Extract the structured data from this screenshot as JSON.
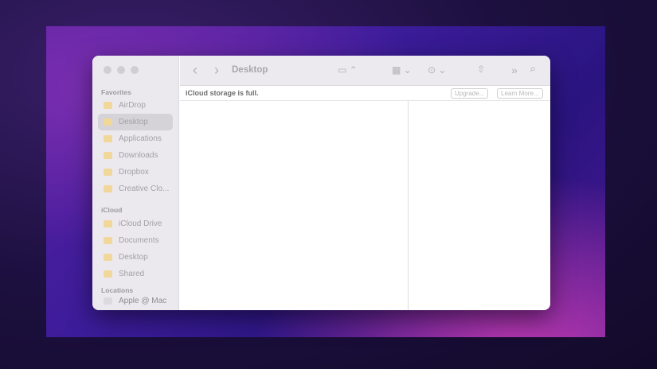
{
  "window": {
    "title": "Desktop"
  },
  "sidebar": {
    "favorites_label": "Favorites",
    "favorites": [
      {
        "label": "AirDrop"
      },
      {
        "label": "Desktop",
        "selected": true
      },
      {
        "label": "Applications"
      },
      {
        "label": "Downloads"
      },
      {
        "label": "Dropbox"
      },
      {
        "label": "Creative Clo..."
      }
    ],
    "icloud_label": "iCloud",
    "icloud": [
      {
        "label": "iCloud Drive"
      },
      {
        "label": "Documents"
      },
      {
        "label": "Desktop"
      },
      {
        "label": "Shared"
      }
    ],
    "locations_label": "Locations",
    "locations": [
      {
        "label": "Apple @ Mac"
      }
    ]
  },
  "toolbar": {
    "back": "‹",
    "forward": "›",
    "view": "▭ ⌃",
    "group": "▦ ⌄",
    "more": "⊙ ⌄",
    "share": "⇧",
    "overflow": "»",
    "search": "⌕"
  },
  "banner": {
    "message": "iCloud storage is full.",
    "upgrade": "Upgrade...",
    "learn_more": "Learn More..."
  }
}
